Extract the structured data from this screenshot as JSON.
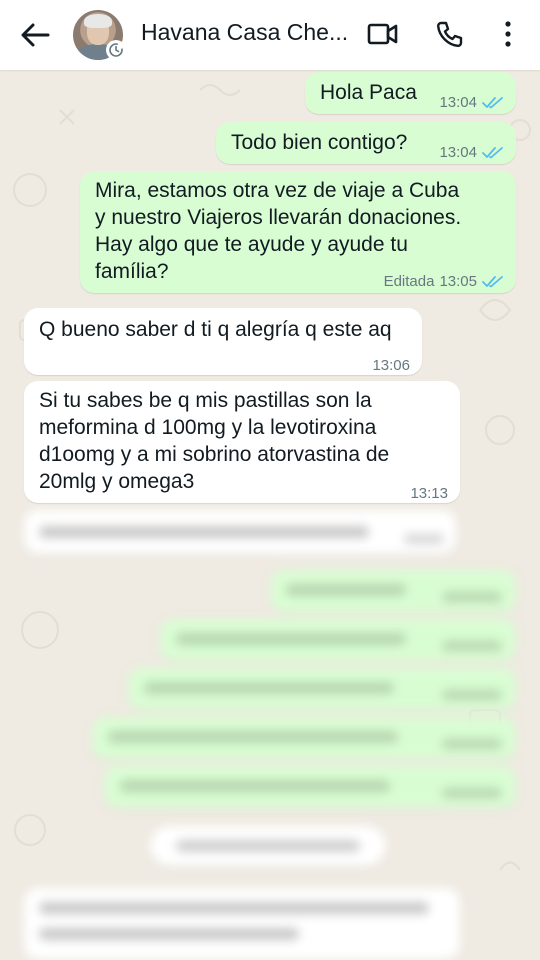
{
  "header": {
    "title": "Havana Casa Che...",
    "icons": {
      "back": "arrow-left-icon",
      "video": "video-camera-icon",
      "call": "phone-icon",
      "menu": "more-vertical-icon",
      "badge": "disappearing-timer-icon"
    }
  },
  "colors": {
    "outgoing": "#d9fdd3",
    "incoming": "#ffffff",
    "tick": "#53bdeb",
    "background": "#efeae2"
  },
  "messages": [
    {
      "dir": "out",
      "text": "Hola Paca",
      "time": "13:04",
      "status": "read"
    },
    {
      "dir": "out",
      "text": "Todo bien contigo?",
      "time": "13:04",
      "status": "read"
    },
    {
      "dir": "out",
      "text": "Mira, estamos otra vez de viaje a Cuba\ny nuestro Viajeros llevarán donaciones.\nHay algo que te ayude y ayude tu\nfamília?",
      "edited": "Editada",
      "time": "13:05",
      "status": "read"
    },
    {
      "dir": "in",
      "text": "Q bueno saber d ti q alegría q este aq",
      "time": "13:06"
    },
    {
      "dir": "in",
      "text": "Si tu sabes be q mis pastillas son  la\nmeformina d 100mg y la levotiroxina\nd1oomg y a mi sobrino atorvastina de\n20mlg y omega3",
      "time": "13:13"
    }
  ]
}
